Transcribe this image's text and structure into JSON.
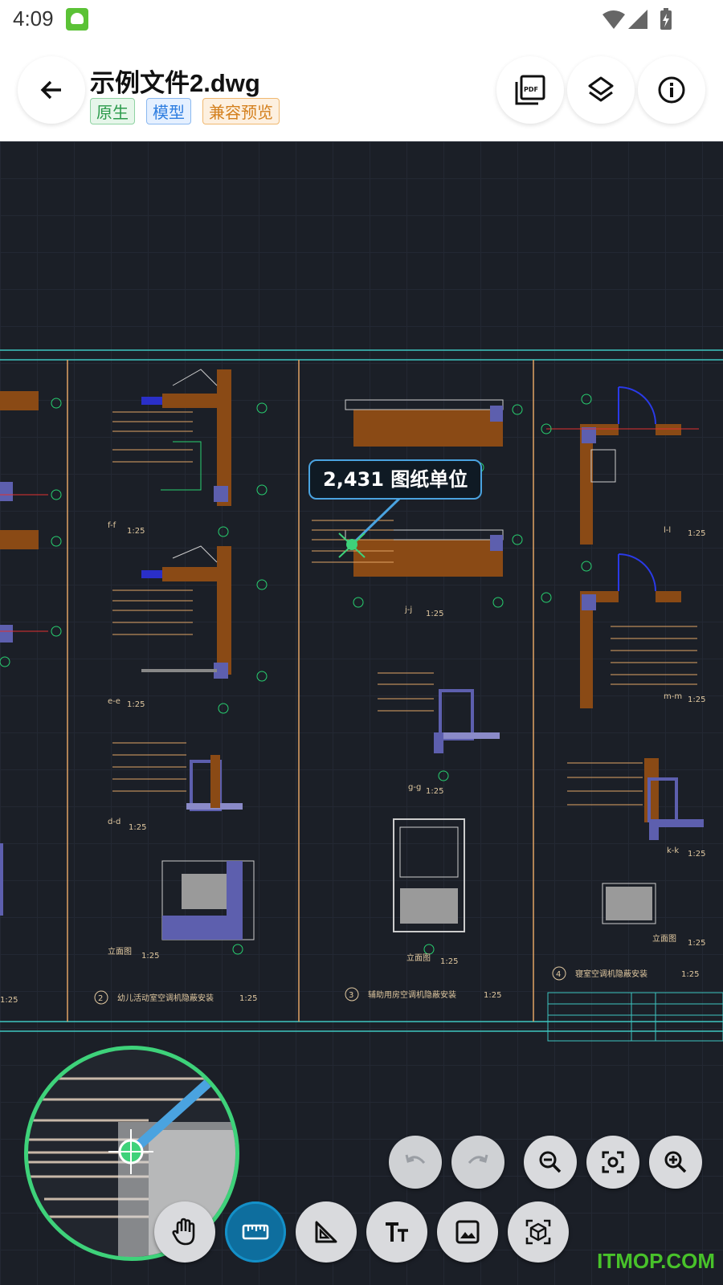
{
  "status_bar": {
    "time": "4:09"
  },
  "header": {
    "title": "示例文件2.dwg",
    "tags": [
      "原生",
      "模型",
      "兼容预览"
    ]
  },
  "drawing": {
    "sections": [
      {
        "label": "f-f",
        "scale": "1:25"
      },
      {
        "label": "e-e",
        "scale": "1:25"
      },
      {
        "label": "d-d",
        "scale": "1:25"
      },
      {
        "label": "立面图",
        "scale": "1:25"
      },
      {
        "label": "j-j",
        "scale": "1:25"
      },
      {
        "label": "g-g",
        "scale": "1:25"
      },
      {
        "label": "立面图",
        "scale": "1:25"
      },
      {
        "label": "l-l",
        "scale": "1:25"
      },
      {
        "label": "m-m",
        "scale": "1:25"
      },
      {
        "label": "k-k",
        "scale": "1:25"
      },
      {
        "label": "立面图",
        "scale": "1:25"
      }
    ],
    "captions": [
      {
        "num": "2",
        "text": "幼儿活动室空调机隐蔽安装",
        "scale": "1:25"
      },
      {
        "num": "3",
        "text": "辅助用房空调机隐蔽安装",
        "scale": "1:25"
      },
      {
        "num": "4",
        "text": "寝室空调机隐蔽安装",
        "scale": "1:25"
      }
    ],
    "left_scale": "1:25"
  },
  "measurement": {
    "label": "2,431 图纸单位"
  },
  "watermark": "ITMOP.COM",
  "colors": {
    "accent": "#1490c8",
    "magnifier_ring": "#3ed27a",
    "canvas_bg": "#1b1f27"
  }
}
